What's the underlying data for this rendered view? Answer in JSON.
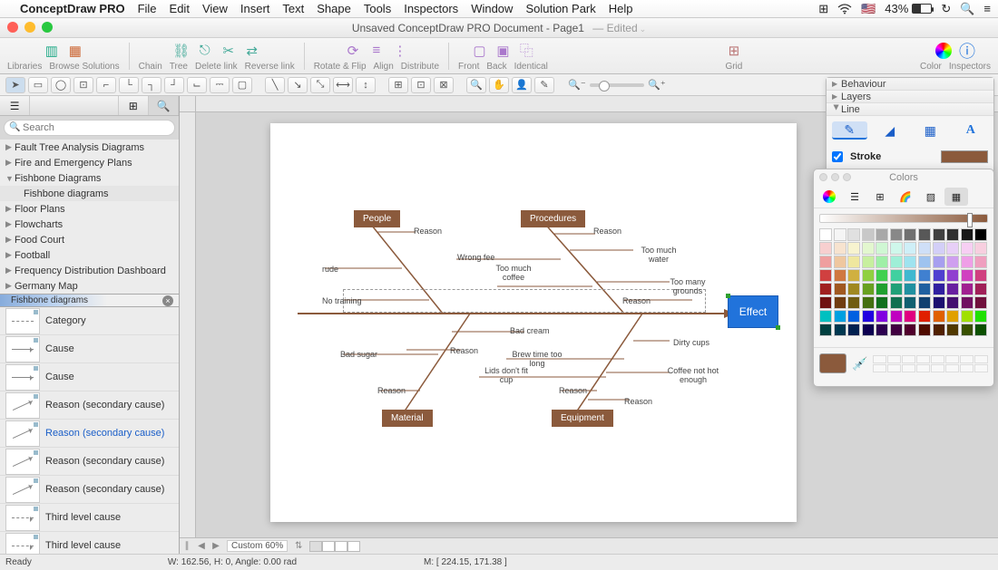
{
  "menubar": {
    "appname": "ConceptDraw PRO",
    "items": [
      "File",
      "Edit",
      "View",
      "Insert",
      "Text",
      "Shape",
      "Tools",
      "Inspectors",
      "Window",
      "Solution Park",
      "Help"
    ],
    "battery": "43%"
  },
  "titlebar": {
    "title": "Unsaved ConceptDraw PRO Document - Page1",
    "edited": "— Edited"
  },
  "toolbar": {
    "g1": [
      "Libraries",
      "Browse Solutions"
    ],
    "g2": [
      "Chain",
      "Tree",
      "Delete link",
      "Reverse link"
    ],
    "g3": [
      "Rotate & Flip",
      "Align",
      "Distribute"
    ],
    "g4": [
      "Front",
      "Back",
      "Identical"
    ],
    "g5": [
      "Grid"
    ],
    "g6": [
      "Color",
      "Inspectors"
    ]
  },
  "search_placeholder": "Search",
  "tree": [
    "Fault Tree Analysis Diagrams",
    "Fire and Emergency Plans",
    "Fishbone Diagrams",
    "Fishbone diagrams",
    "Floor Plans",
    "Flowcharts",
    "Food Court",
    "Football",
    "Frequency Distribution Dashboard",
    "Germany Map"
  ],
  "active_tab": "Fishbone diagrams",
  "shapes": [
    "Category",
    "Cause",
    "Cause",
    "Reason (secondary cause)",
    "Reason (secondary cause)",
    "Reason (secondary cause)",
    "Reason (secondary cause)",
    "Third level cause",
    "Third level cause"
  ],
  "shapes_selected_index": 4,
  "fishbone": {
    "effect": "Effect",
    "cats": {
      "people": "People",
      "procedures": "Procedures",
      "material": "Material",
      "equipment": "Equipment"
    },
    "labels": {
      "reason": "Reason",
      "rude": "rude",
      "no_training": "No training",
      "wrong_fee": "Wrong fee",
      "too_much_coffee": "Too much coffee",
      "too_much_water": "Too much water",
      "too_many_grounds": "Too many grounds",
      "bad_cream": "Bad cream",
      "bad_sugar": "Bad sugar",
      "lids": "Lids don't fit cup",
      "brew": "Brew time too long",
      "coffee_hot": "Coffee not hot enough",
      "dirty": "Dirty cups"
    }
  },
  "inspector": {
    "sections": [
      "Behaviour",
      "Layers",
      "Line"
    ],
    "stroke_label": "Stroke"
  },
  "colors_title": "Colors",
  "colorgrid": [
    "#ffffff",
    "#f5f5f5",
    "#e0e0e0",
    "#c8c8c8",
    "#a8a8a8",
    "#888888",
    "#707070",
    "#585858",
    "#404040",
    "#303030",
    "#181818",
    "#000000",
    "#f7cfcf",
    "#f7e3cf",
    "#f7f3cf",
    "#e3f7cf",
    "#cff7d3",
    "#cff7eb",
    "#cfeff7",
    "#cfdff7",
    "#d3cff7",
    "#e7cff7",
    "#f7cff3",
    "#f7cfdf",
    "#ef9f9f",
    "#efc79f",
    "#efe79f",
    "#c7ef9f",
    "#9fefa7",
    "#9fefd7",
    "#9fe3ef",
    "#9fc3ef",
    "#a79fef",
    "#cf9fef",
    "#ef9fe7",
    "#ef9fbf",
    "#d04040",
    "#d07840",
    "#d0b040",
    "#90d040",
    "#40d050",
    "#40d0a0",
    "#40b8d0",
    "#4080d0",
    "#5040d0",
    "#9040d0",
    "#d040c0",
    "#d04080",
    "#a02020",
    "#a05820",
    "#a08820",
    "#68a020",
    "#20a030",
    "#20a078",
    "#2090a0",
    "#2060a0",
    "#3020a0",
    "#6820a0",
    "#a02090",
    "#a02058",
    "#701010",
    "#703c10",
    "#705c10",
    "#447010",
    "#10701c",
    "#107050",
    "#106070",
    "#104070",
    "#1c1070",
    "#441070",
    "#701060",
    "#70103c",
    "#00c0c0",
    "#00a0e0",
    "#0060e0",
    "#2000e0",
    "#8000e0",
    "#c000c0",
    "#e00080",
    "#e02000",
    "#e06000",
    "#e0a000",
    "#a0e000",
    "#20e000",
    "#004040",
    "#003850",
    "#002050",
    "#0c0050",
    "#2c0050",
    "#400040",
    "#50002c",
    "#500c00",
    "#502000",
    "#503800",
    "#385000",
    "#0c5000"
  ],
  "hscroll": {
    "zoom": "Custom 60%"
  },
  "status": {
    "ready": "Ready",
    "wh": "W: 162.56,  H: 0,  Angle: 0.00 rad",
    "mouse": "M: [ 224.15, 171.38 ]"
  }
}
